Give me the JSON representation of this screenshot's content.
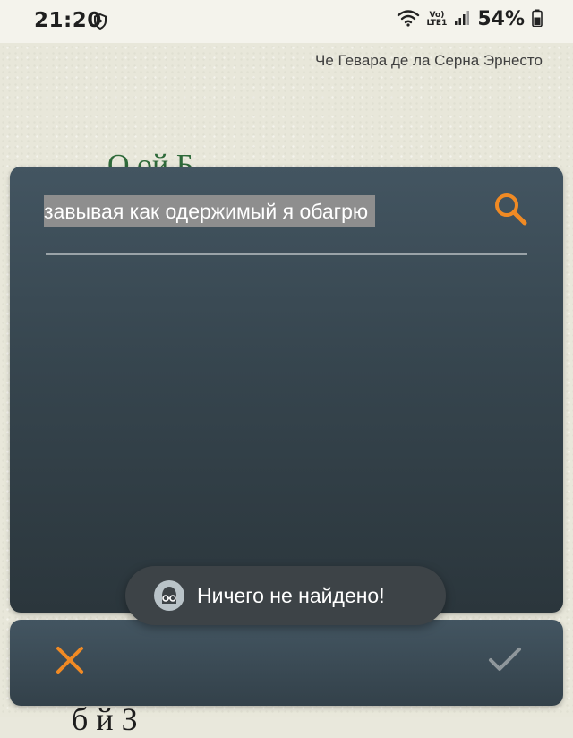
{
  "status_bar": {
    "time": "21:20",
    "lte_top": "Vo)",
    "lte_bottom": "LTE1",
    "battery": "54%",
    "icons": [
      "shield-icon",
      "wifi-icon",
      "signal-icon",
      "battery-icon"
    ]
  },
  "book": {
    "author": "Че Гевара де ла Серна Эрнесто",
    "heading_partial": "О             ой Б",
    "bottom_line_partial": "б                    й З"
  },
  "search": {
    "query": "завывая как одержимый я обагрю",
    "icon": "search-icon"
  },
  "toast": {
    "message": "Ничего не найдено!",
    "icon": "app-logo-icon"
  },
  "actions": {
    "cancel_icon": "close-icon",
    "confirm_icon": "checkmark-icon"
  },
  "colors": {
    "accent": "#f08a24",
    "panel": "#3a4a54",
    "paper": "#e8e7da"
  }
}
